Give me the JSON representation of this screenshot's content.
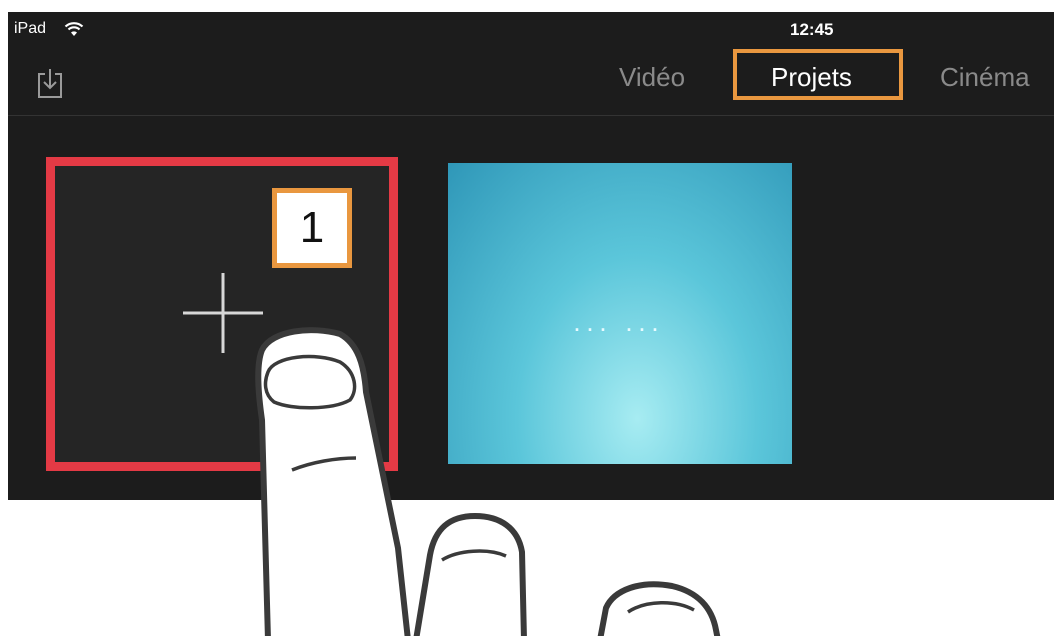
{
  "status_bar": {
    "device": "iPad",
    "time": "12:45"
  },
  "toolbar": {
    "import_icon": "tray-import-icon",
    "tabs": [
      {
        "label": "Vidéo",
        "active": false
      },
      {
        "label": "Projets",
        "active": true
      },
      {
        "label": "Cinéma",
        "active": false
      }
    ]
  },
  "projects": {
    "new_project_icon": "plus-icon",
    "thumbnail_text": "... ..."
  },
  "annotations": {
    "step_number": "1",
    "highlight_color": "#e9973f",
    "selection_color": "#e43a45"
  }
}
